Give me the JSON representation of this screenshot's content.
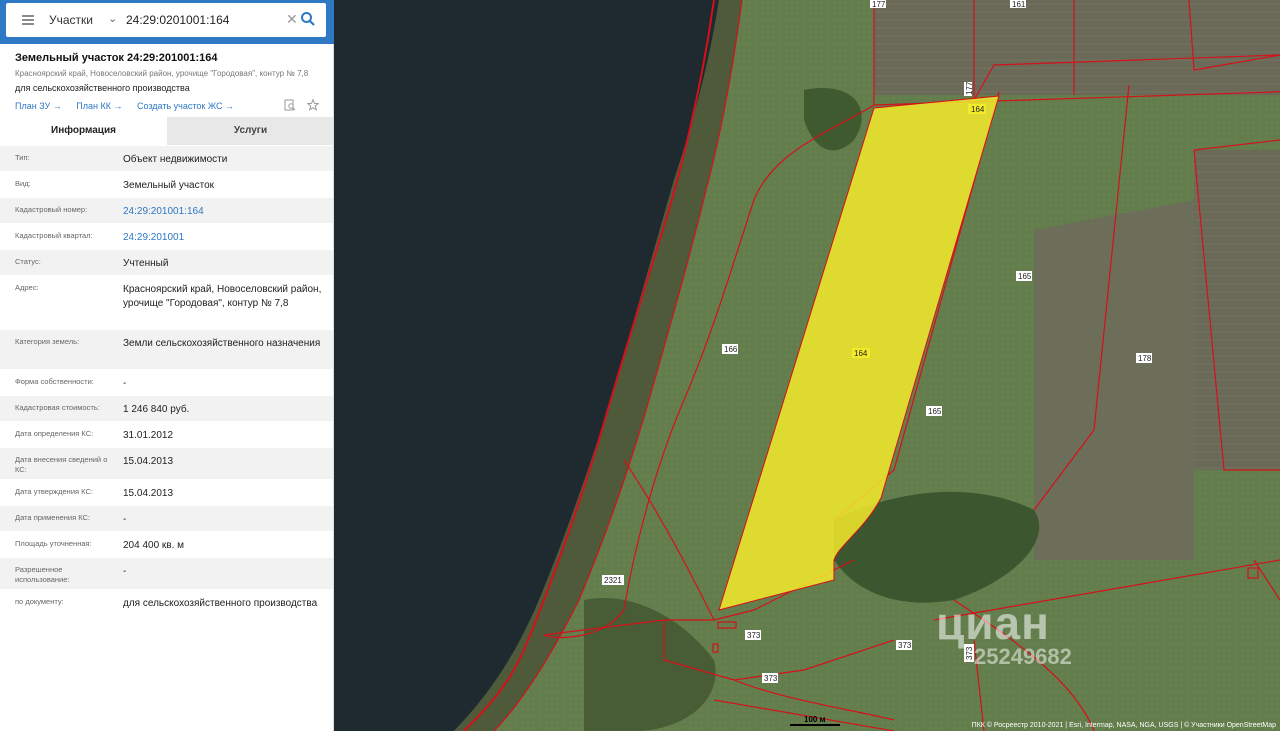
{
  "search": {
    "type_label": "Участки",
    "value": "24:29:0201001:164",
    "chevron": "⌄",
    "clear": "✕",
    "collapse": "‹"
  },
  "parcel": {
    "title": "Земельный участок 24:29:201001:164",
    "address_line": "Красноярский край, Новоселовский район, урочище \"Городовая\", контур № 7,8",
    "use_line": "для сельскохозяйственного производства",
    "links": [
      "План ЗУ →",
      "План КК →",
      "Создать участок ЖС →"
    ]
  },
  "tabs": {
    "info": "Информация",
    "services": "Услуги"
  },
  "attributes": [
    {
      "key": "Тип:",
      "value": "Объект недвижимости"
    },
    {
      "key": "Вид:",
      "value": "Земельный участок"
    },
    {
      "key": "Кадастровый номер:",
      "value": "24:29:201001:164"
    },
    {
      "key": "Кадастровый квартал:",
      "value": "24:29:201001"
    },
    {
      "key": "Статус:",
      "value": "Учтенный"
    },
    {
      "key": "Адрес:",
      "value": "Красноярский край, Новоселовский район, урочище \"Городовая\", контур № 7,8"
    },
    {
      "key": "Категория земель:",
      "value": "Земли сельскохозяйственного назначения"
    },
    {
      "key": "Форма собственности:",
      "value": "-"
    },
    {
      "key": "Кадастровая стоимость:",
      "value": "1 246 840 руб."
    },
    {
      "key": "Дата определения КС:",
      "value": "31.01.2012"
    },
    {
      "key": "Дата внесения сведений о КС:",
      "value": "15.04.2013"
    },
    {
      "key": "Дата утверждения КС:",
      "value": "15.04.2013"
    },
    {
      "key": "Дата применения КС:",
      "value": "-"
    },
    {
      "key": "Площадь уточненная:",
      "value": "204 400 кв. м"
    },
    {
      "key": "Разрешенное использование:",
      "value": "-"
    },
    {
      "key": "по документу:",
      "value": "для сельскохозяйственного производства"
    }
  ],
  "map": {
    "parcel_labels": [
      "177",
      "161",
      "177",
      "164",
      "165",
      "166",
      "164",
      "178",
      "165",
      "2321",
      "373",
      "373",
      "373",
      "373"
    ],
    "watermark": "циан",
    "watermark_id": "25249682",
    "scale_label": "100 м",
    "attribution": "ПКК © Росреестр 2010-2021 | Esri, Intermap, NASA, NGA, USGS | © Участники OpenStreetMap",
    "colors": {
      "water": "#1f2a30",
      "boundary": "#d6101a",
      "highlight": "#f3ea2a",
      "field": "#5e7a4a"
    }
  },
  "icons": [
    "menu-icon",
    "chevron-down-icon",
    "close-icon",
    "search-icon",
    "collapse-icon",
    "document-search-icon",
    "star-icon"
  ]
}
